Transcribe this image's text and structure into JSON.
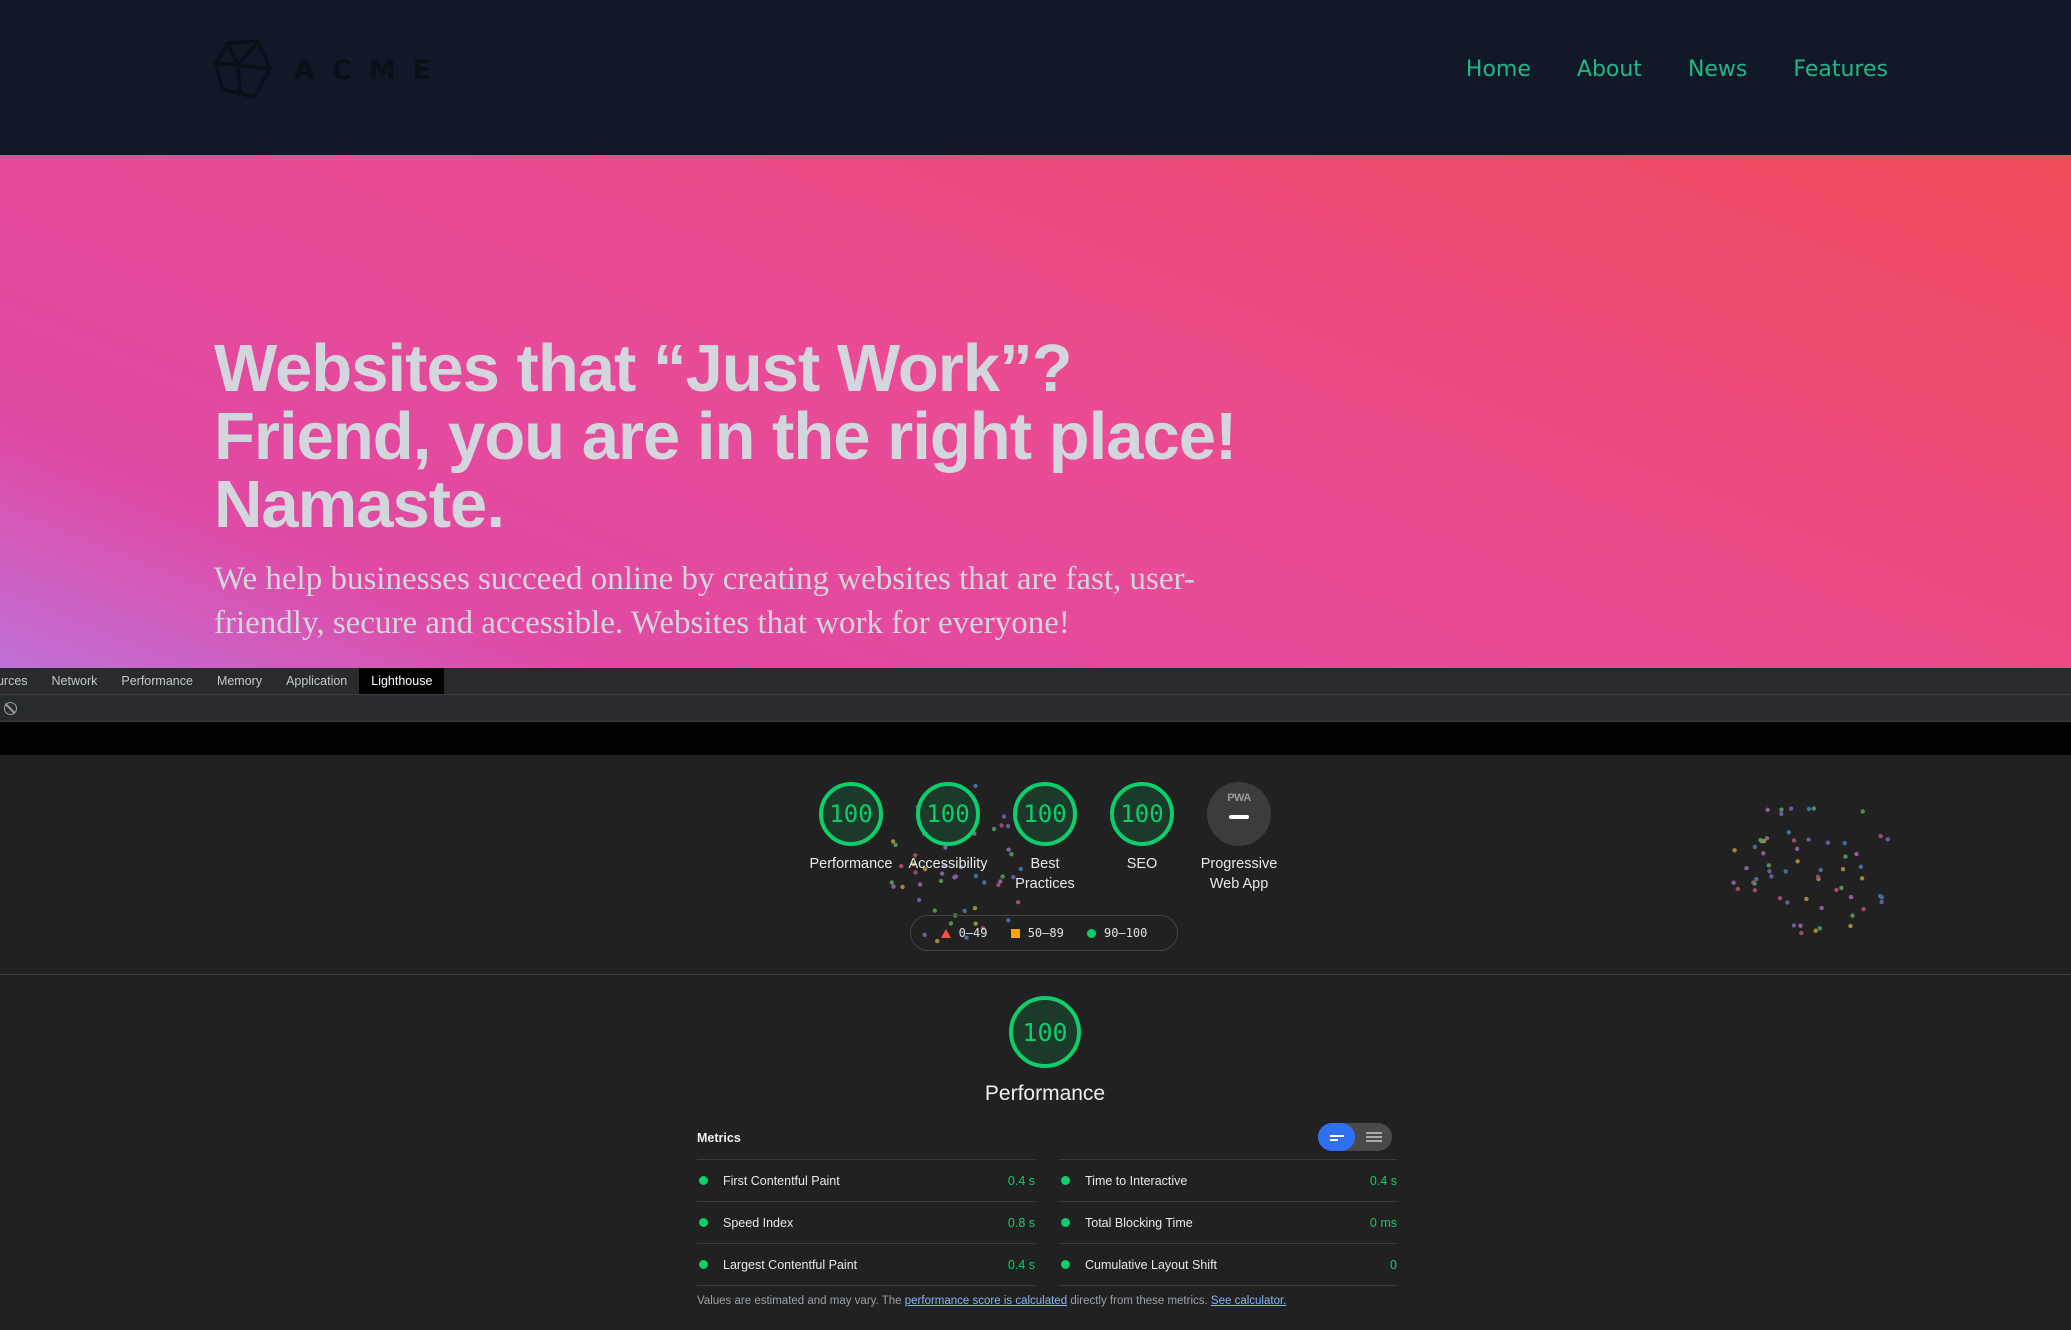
{
  "site": {
    "brand": "ACME",
    "nav": [
      "Home",
      "About",
      "News",
      "Features"
    ]
  },
  "hero": {
    "title_lines": [
      "Websites that “Just Work”?",
      "Friend, you are in the right place!",
      "Namaste."
    ],
    "subtitle": "We help businesses succeed online by creating websites that are fast, user-friendly, secure and accessible. Websites that work for everyone!"
  },
  "devtools": {
    "tabs": [
      "ources",
      "Network",
      "Performance",
      "Memory",
      "Application",
      "Lighthouse"
    ],
    "active_tab": "Lighthouse"
  },
  "report": {
    "gauges": [
      {
        "score": "100",
        "label": "Performance"
      },
      {
        "score": "100",
        "label": "Accessibility"
      },
      {
        "score": "100",
        "label": "Best Practices"
      },
      {
        "score": "100",
        "label": "SEO"
      }
    ],
    "pwa": {
      "badge": "PWA",
      "label": "Progressive Web App"
    },
    "legend": [
      {
        "range": "0–49",
        "color": "#ff4e42"
      },
      {
        "range": "50–89",
        "color": "#ffa400"
      },
      {
        "range": "90–100",
        "color": "#0cce6b"
      }
    ],
    "performance": {
      "score": "100",
      "title": "Performance",
      "metrics_heading": "Metrics",
      "metrics_left": [
        {
          "name": "First Contentful Paint",
          "value": "0.4 s"
        },
        {
          "name": "Speed Index",
          "value": "0.8 s"
        },
        {
          "name": "Largest Contentful Paint",
          "value": "0.4 s"
        }
      ],
      "metrics_right": [
        {
          "name": "Time to Interactive",
          "value": "0.4 s"
        },
        {
          "name": "Total Blocking Time",
          "value": "0 ms"
        },
        {
          "name": "Cumulative Layout Shift",
          "value": "0"
        }
      ],
      "footnote_prefix": "Values are estimated and may vary. The",
      "footnote_link1": "performance score is calculated",
      "footnote_mid": "directly from these metrics.",
      "footnote_link2": "See calculator."
    }
  },
  "colors": {
    "pass": "#0cce6b",
    "nav_link": "#1fb886",
    "header_bg": "#111827"
  }
}
